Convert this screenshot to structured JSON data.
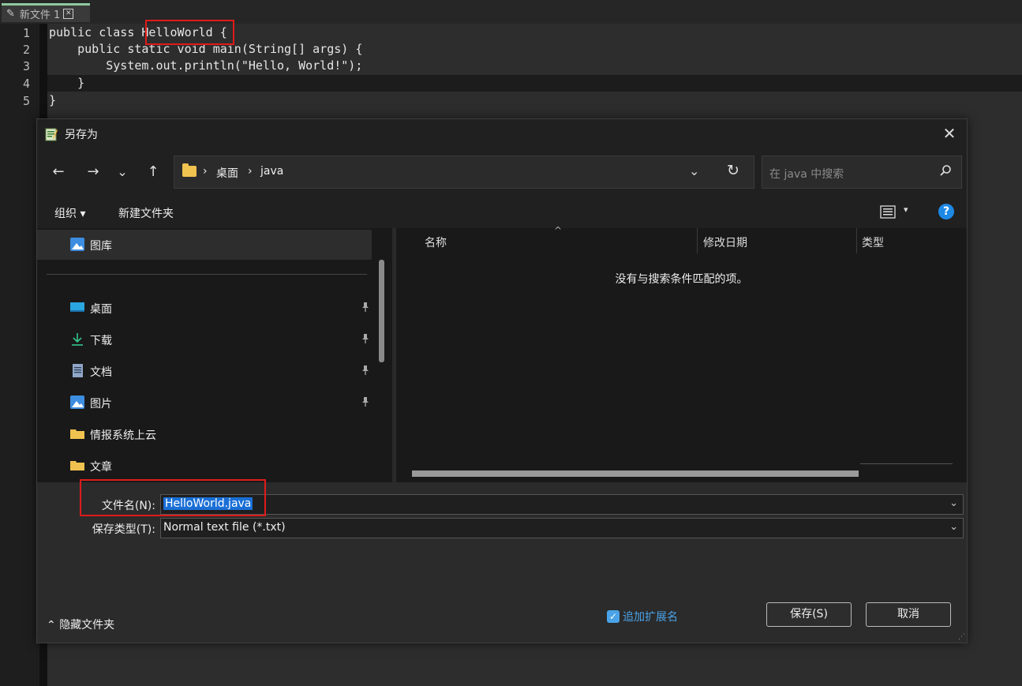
{
  "editor": {
    "tab_label": "新文件 1",
    "line_numbers": [
      "1",
      "2",
      "3",
      "4",
      "5"
    ],
    "code_lines": [
      "public class HelloWorld {",
      "    public static void main(String[] args) {",
      "        System.out.println(\"Hello, World!\");",
      "    }",
      "}"
    ]
  },
  "dialog": {
    "title": "另存为",
    "close_symbol": "✕",
    "nav": {
      "back_symbol": "←",
      "forward_symbol": "→",
      "recent_symbol": "⌄",
      "up_symbol": "↑"
    },
    "address": {
      "separator": "›",
      "crumbs": [
        "桌面",
        "java"
      ]
    },
    "search_placeholder": "在 java 中搜索",
    "toolbar": {
      "organize": "组织 ▾",
      "new_folder": "新建文件夹"
    },
    "nav_pane": {
      "items": [
        {
          "label": "图库",
          "icon": "gallery-icon"
        },
        {
          "label": "桌面",
          "icon": "desktop-icon",
          "pinned": true
        },
        {
          "label": "下载",
          "icon": "download-icon",
          "pinned": true
        },
        {
          "label": "文档",
          "icon": "document-icon",
          "pinned": true
        },
        {
          "label": "图片",
          "icon": "pictures-icon",
          "pinned": true
        },
        {
          "label": "情报系统上云",
          "icon": "folder-icon"
        },
        {
          "label": "文章",
          "icon": "folder-icon"
        }
      ]
    },
    "file_list": {
      "columns": [
        "名称",
        "修改日期",
        "类型"
      ],
      "empty_message": "没有与搜索条件匹配的项。"
    },
    "filename_label": "文件名(N):",
    "filename_value": "HelloWorld.java",
    "filetype_label": "保存类型(T):",
    "filetype_value": "Normal text file (*.txt)",
    "hide_folders": "隐藏文件夹",
    "append_extension": "追加扩展名",
    "append_extension_checked": true,
    "save_button": "保存(S)",
    "cancel_button": "取消"
  },
  "colors": {
    "accent_blue": "#1a6fd6",
    "highlight_red": "#e01b1b",
    "folder_yellow": "#f0c24f"
  }
}
